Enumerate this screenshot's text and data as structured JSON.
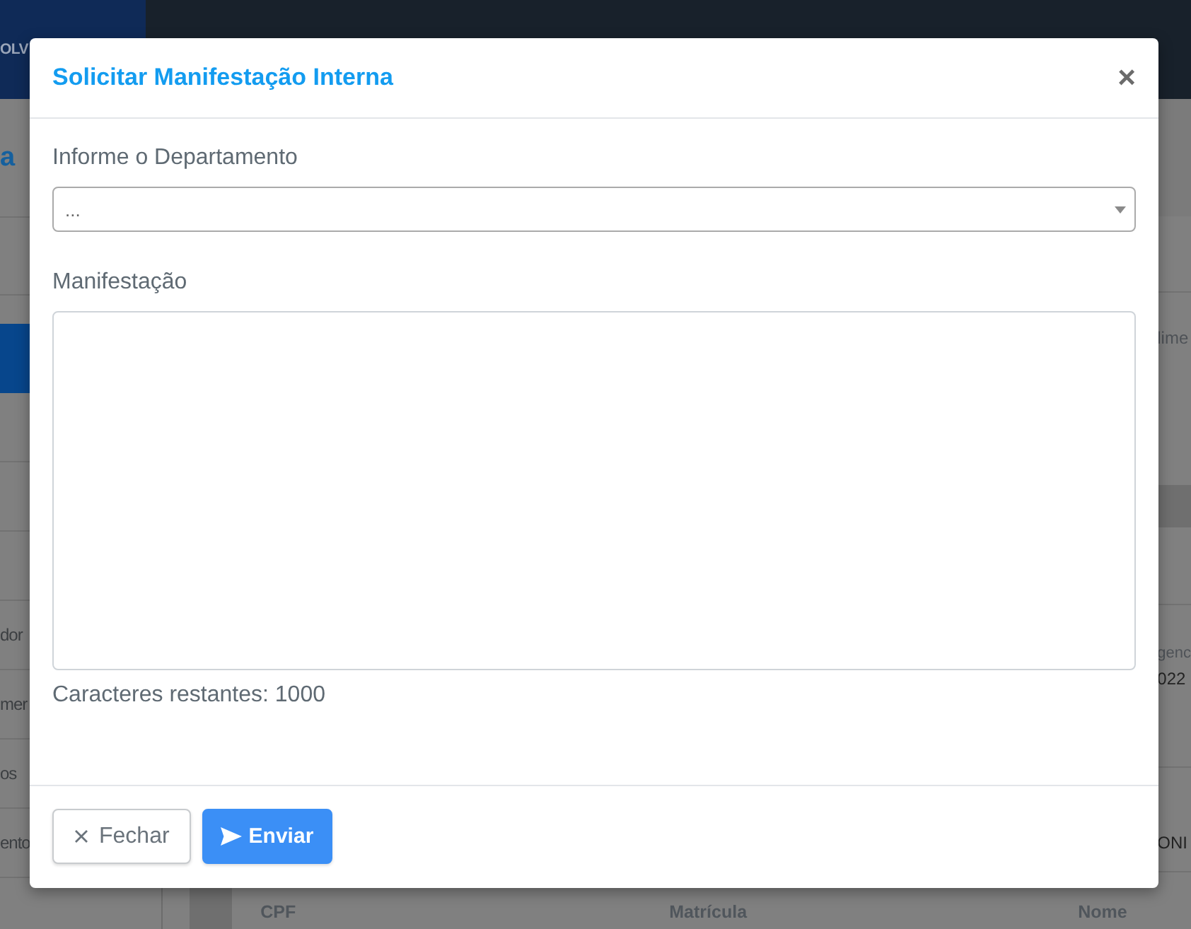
{
  "header": {
    "brand": "OLV"
  },
  "sidebar": {
    "heading": "a",
    "items": [
      {
        "selected": true
      },
      {
        "selected": false
      },
      {
        "selected": false
      },
      {
        "selected": false
      },
      {
        "label": "dor",
        "selected": false
      },
      {
        "label": "mer",
        "selected": false
      },
      {
        "label": "os",
        "selected": false
      },
      {
        "label": "ento",
        "selected": false
      },
      {
        "selected": false
      }
    ]
  },
  "main": {
    "panels": [
      {
        "label": "lime"
      },
      {
        "label": "genc",
        "value": "022"
      },
      {
        "value": "ONI"
      }
    ],
    "table": {
      "columns": [
        "CPF",
        "Matrícula",
        "Nome"
      ]
    }
  },
  "dialog": {
    "title": "Solicitar Manifestação Interna",
    "close": "×",
    "fields": [
      {
        "kind": "select",
        "label": "Informe o Departamento",
        "value": "..."
      },
      {
        "kind": "textarea",
        "label": "Manifestação",
        "counter": "Caracteres restantes: 1000"
      }
    ],
    "buttons": [
      {
        "kind": "secondary",
        "label": "Fechar"
      },
      {
        "kind": "primary",
        "label": "Enviar"
      }
    ]
  }
}
